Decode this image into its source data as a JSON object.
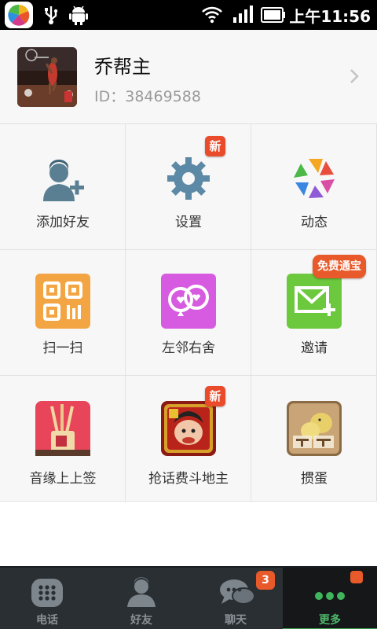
{
  "status_bar": {
    "time": "上午11:56"
  },
  "profile": {
    "nickname": "乔帮主",
    "id_text": "ID：38469588"
  },
  "grid": {
    "items": [
      {
        "label": "添加好友",
        "icon": "add-friend-icon"
      },
      {
        "label": "设置",
        "icon": "gear-icon",
        "badge": "新"
      },
      {
        "label": "动态",
        "icon": "moments-icon"
      },
      {
        "label": "扫一扫",
        "icon": "qr-scan-icon"
      },
      {
        "label": "左邻右舍",
        "icon": "neighbors-icon"
      },
      {
        "label": "邀请",
        "icon": "invite-mail-icon",
        "badge": "免费通宝"
      },
      {
        "label": "音缘上上签",
        "icon": "fortune-sticks-icon"
      },
      {
        "label": "抢话费斗地主",
        "icon": "landlord-game-icon",
        "badge": "新"
      },
      {
        "label": "掼蛋",
        "icon": "guandan-game-icon"
      }
    ]
  },
  "tab_bar": {
    "tabs": [
      {
        "label": "电话",
        "icon": "dialpad-icon"
      },
      {
        "label": "好友",
        "icon": "contacts-icon"
      },
      {
        "label": "聊天",
        "icon": "chat-icon",
        "badge": "3"
      },
      {
        "label": "更多",
        "icon": "more-dots-icon",
        "active": true
      }
    ]
  },
  "colors": {
    "accent_green": "#3a9c4e",
    "badge_red": "#e95a2b",
    "tabbar_bg": "#2a2f33"
  }
}
